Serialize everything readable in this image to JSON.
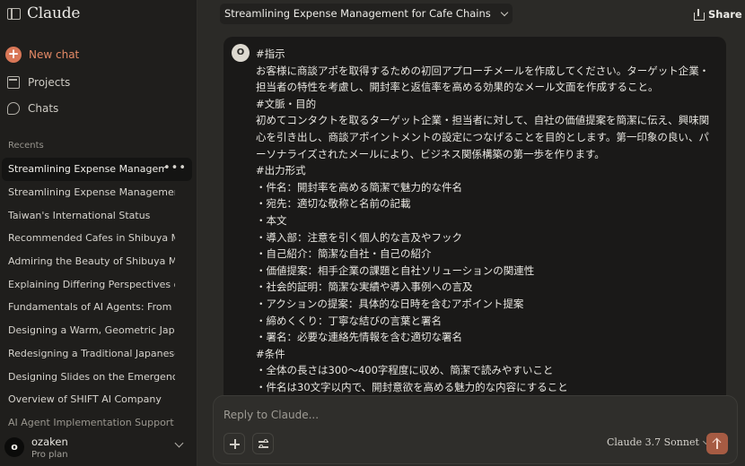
{
  "app": {
    "name": "Claude"
  },
  "sidebar": {
    "new_chat": "New chat",
    "nav": [
      {
        "label": "Projects",
        "icon": "folder-icon"
      },
      {
        "label": "Chats",
        "icon": "chat-bubble-icon"
      }
    ],
    "recents_heading": "Recents",
    "recents": [
      "Streamlining Expense Management for Cafe Chains",
      "Streamlining Expense Management for Cafe Chains",
      "Taiwan's International Status",
      "Recommended Cafes in Shibuya Minami",
      "Admiring the Beauty of Shibuya Minami",
      "Explaining Differing Perspectives on Taiwan",
      "Fundamentals of AI Agents: From Basics",
      "Designing a Warm, Geometric Japanese Logo",
      "Redesigning a Traditional Japanese Logo",
      "Designing Slides on the Emergence of AI",
      "Overview of SHIFT AI Company",
      "AI Agent Implementation Support"
    ],
    "user": {
      "initial": "o",
      "name": "ozaken",
      "plan": "Pro plan"
    }
  },
  "header": {
    "title": "Streamlining Expense Management for Cafe Chains",
    "share_label": "Share"
  },
  "message": {
    "avatar_initial": "O",
    "lines": [
      "#指示",
      "お客様に商談アポを取得するための初回アプローチメールを作成してください。ターゲット企業・",
      "担当者の特性を考慮し、開封率と返信率を高める効果的なメール文面を作成すること。",
      "#文脈・目的",
      "初めてコンタクトを取るターゲット企業・担当者に対して、自社の価値提案を簡潔に伝え、興味関",
      "心を引き出し、商談アポイントメントの設定につなげることを目的とします。第一印象の良い、パ",
      "ーソナライズされたメールにより、ビジネス関係構築の第一歩を作ります。",
      "#出力形式",
      "・件名：開封率を高める簡潔で魅力的な件名",
      "・宛先：適切な敬称と名前の記載",
      "・本文",
      "・導入部：注意を引く個人的な言及やフック",
      "・自己紹介：簡潔な自社・自己の紹介",
      "・価値提案：相手企業の課題と自社ソリューションの関連性",
      "・社会的証明：簡潔な実績や導入事例への言及",
      "・アクションの提案：具体的な日時を含むアポイント提案",
      "・締めくくり：丁寧な結びの言葉と署名",
      "・署名：必要な連絡先情報を含む適切な署名",
      "#条件",
      "・全体の長さは300〜400字程度に収め、簡潔で読みやすいこと",
      "・件名は30文字以内で、開封意欲を高める魅力的な内容にすること"
    ]
  },
  "composer": {
    "placeholder": "Reply to Claude...",
    "model": "Claude 3.7 Sonnet"
  },
  "colors": {
    "accent": "#d97757",
    "send_button": "#a65b43",
    "sidebar_bg": "#1f1e1c",
    "main_bg": "#2b2a27"
  }
}
